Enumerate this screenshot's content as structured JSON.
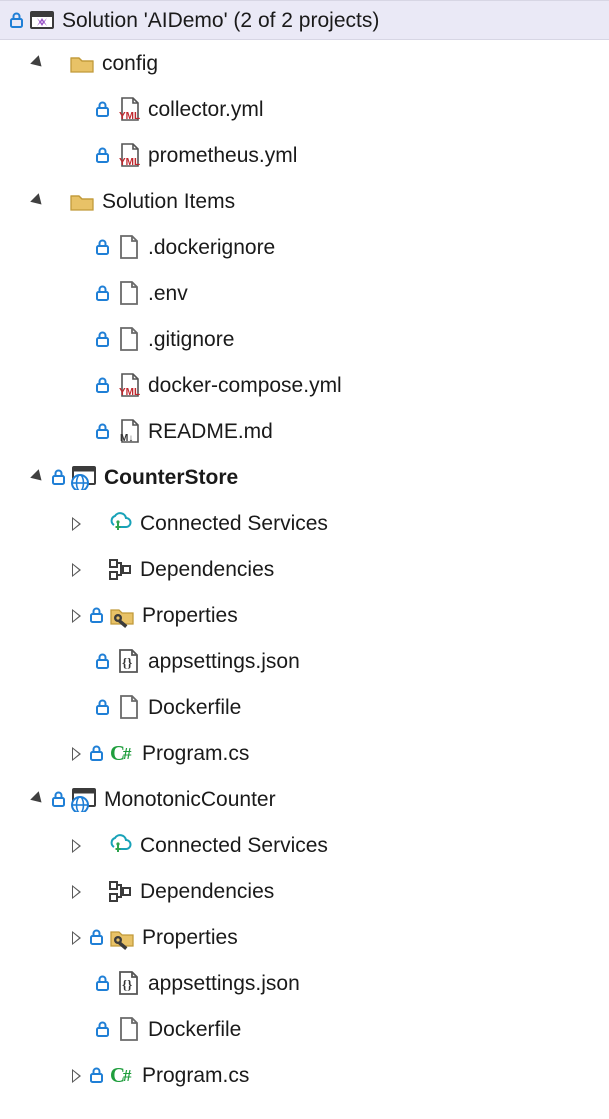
{
  "solution": {
    "header": "Solution 'AIDemo' (2 of 2 projects)"
  },
  "config": {
    "name": "config",
    "collector": "collector.yml",
    "prometheus": "prometheus.yml"
  },
  "solution_items": {
    "name": "Solution Items",
    "dockerignore": ".dockerignore",
    "env": ".env",
    "gitignore": ".gitignore",
    "compose": "docker-compose.yml",
    "readme": "README.md"
  },
  "project1": {
    "name": "CounterStore",
    "connected": "Connected Services",
    "deps": "Dependencies",
    "props": "Properties",
    "appsettings": "appsettings.json",
    "dockerfile": "Dockerfile",
    "program": "Program.cs"
  },
  "project2": {
    "name": "MonotonicCounter",
    "connected": "Connected Services",
    "deps": "Dependencies",
    "props": "Properties",
    "appsettings": "appsettings.json",
    "dockerfile": "Dockerfile",
    "program": "Program.cs"
  }
}
